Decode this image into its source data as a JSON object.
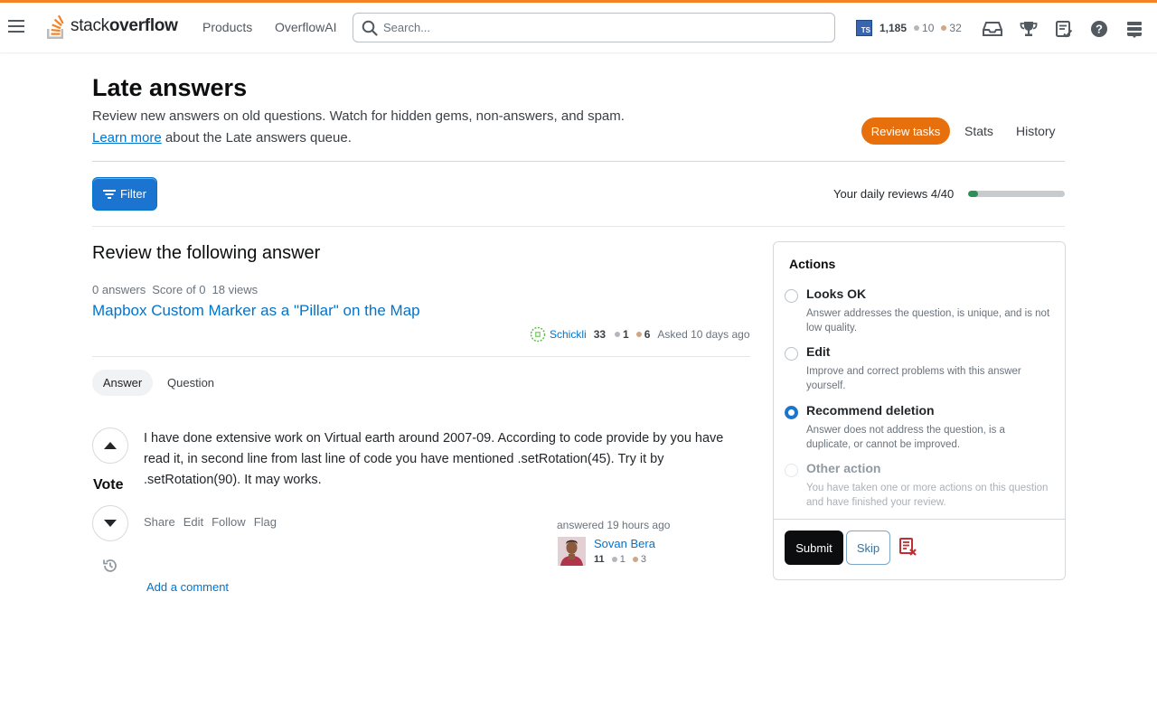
{
  "topbar": {
    "logo_text_light": "stack",
    "logo_text_bold": "overflow",
    "nav": [
      "Products",
      "OverflowAI"
    ],
    "search_placeholder": "Search...",
    "user": {
      "avatar_initials": "TS",
      "reputation": "1,185",
      "silver_badges": "10",
      "bronze_badges": "32"
    },
    "icons": [
      "inbox-icon",
      "achievements-icon",
      "review-queue-icon",
      "help-icon",
      "site-switcher-icon"
    ]
  },
  "header": {
    "title": "Late answers",
    "description": "Review new answers on old questions. Watch for hidden gems, non-answers, and spam.",
    "learn_more": "Learn more",
    "learn_more_suffix": " about the Late answers queue.",
    "tabs": [
      "Review tasks",
      "Stats",
      "History"
    ]
  },
  "toolbar": {
    "filter_label": "Filter",
    "daily_reviews": "Your daily reviews 4/40",
    "progress": 0.1
  },
  "review": {
    "heading": "Review the following answer",
    "question_stats": [
      "0 answers",
      "Score of 0",
      "18 views"
    ],
    "question_title": "Mapbox Custom Marker as a \"Pillar\" on the Map",
    "asker": {
      "name": "Schickli",
      "reputation": "33",
      "silver": "1",
      "bronze": "6",
      "asked": "Asked 10 days ago"
    },
    "tabs": [
      "Answer",
      "Question"
    ],
    "vote_label": "Vote",
    "answer_text": "I have done extensive work on Virtual earth around 2007-09. According to code provide by you have read it, in second line from last line of code you have mentioned .setRotation(45). Try it by .setRotation(90). It may works.",
    "post_menu": [
      "Share",
      "Edit",
      "Follow",
      "Flag"
    ],
    "answered": "answered 19 hours ago",
    "answerer": {
      "name": "Sovan Bera",
      "reputation": "11",
      "silver": "1",
      "bronze": "3"
    },
    "add_comment": "Add a comment"
  },
  "actions": {
    "title": "Actions",
    "options": [
      {
        "label": "Looks OK",
        "desc": "Answer addresses the question, is unique, and is not low quality.",
        "checked": false,
        "disabled": false
      },
      {
        "label": "Edit",
        "desc": "Improve and correct problems with this answer yourself.",
        "checked": false,
        "disabled": false
      },
      {
        "label": "Recommend deletion",
        "desc": "Answer does not address the question, is a duplicate, or cannot be improved.",
        "checked": true,
        "disabled": false
      },
      {
        "label": "Other action",
        "desc": "You have taken one or more actions on this question and have finished your review.",
        "checked": false,
        "disabled": true
      }
    ],
    "submit_label": "Submit",
    "skip_label": "Skip"
  },
  "colors": {
    "accent_orange": "#f48225",
    "review_pill": "#e7700d",
    "link_blue": "#0074cc",
    "primary_button": "#1b75d0",
    "progress_green": "#2f8f58"
  }
}
